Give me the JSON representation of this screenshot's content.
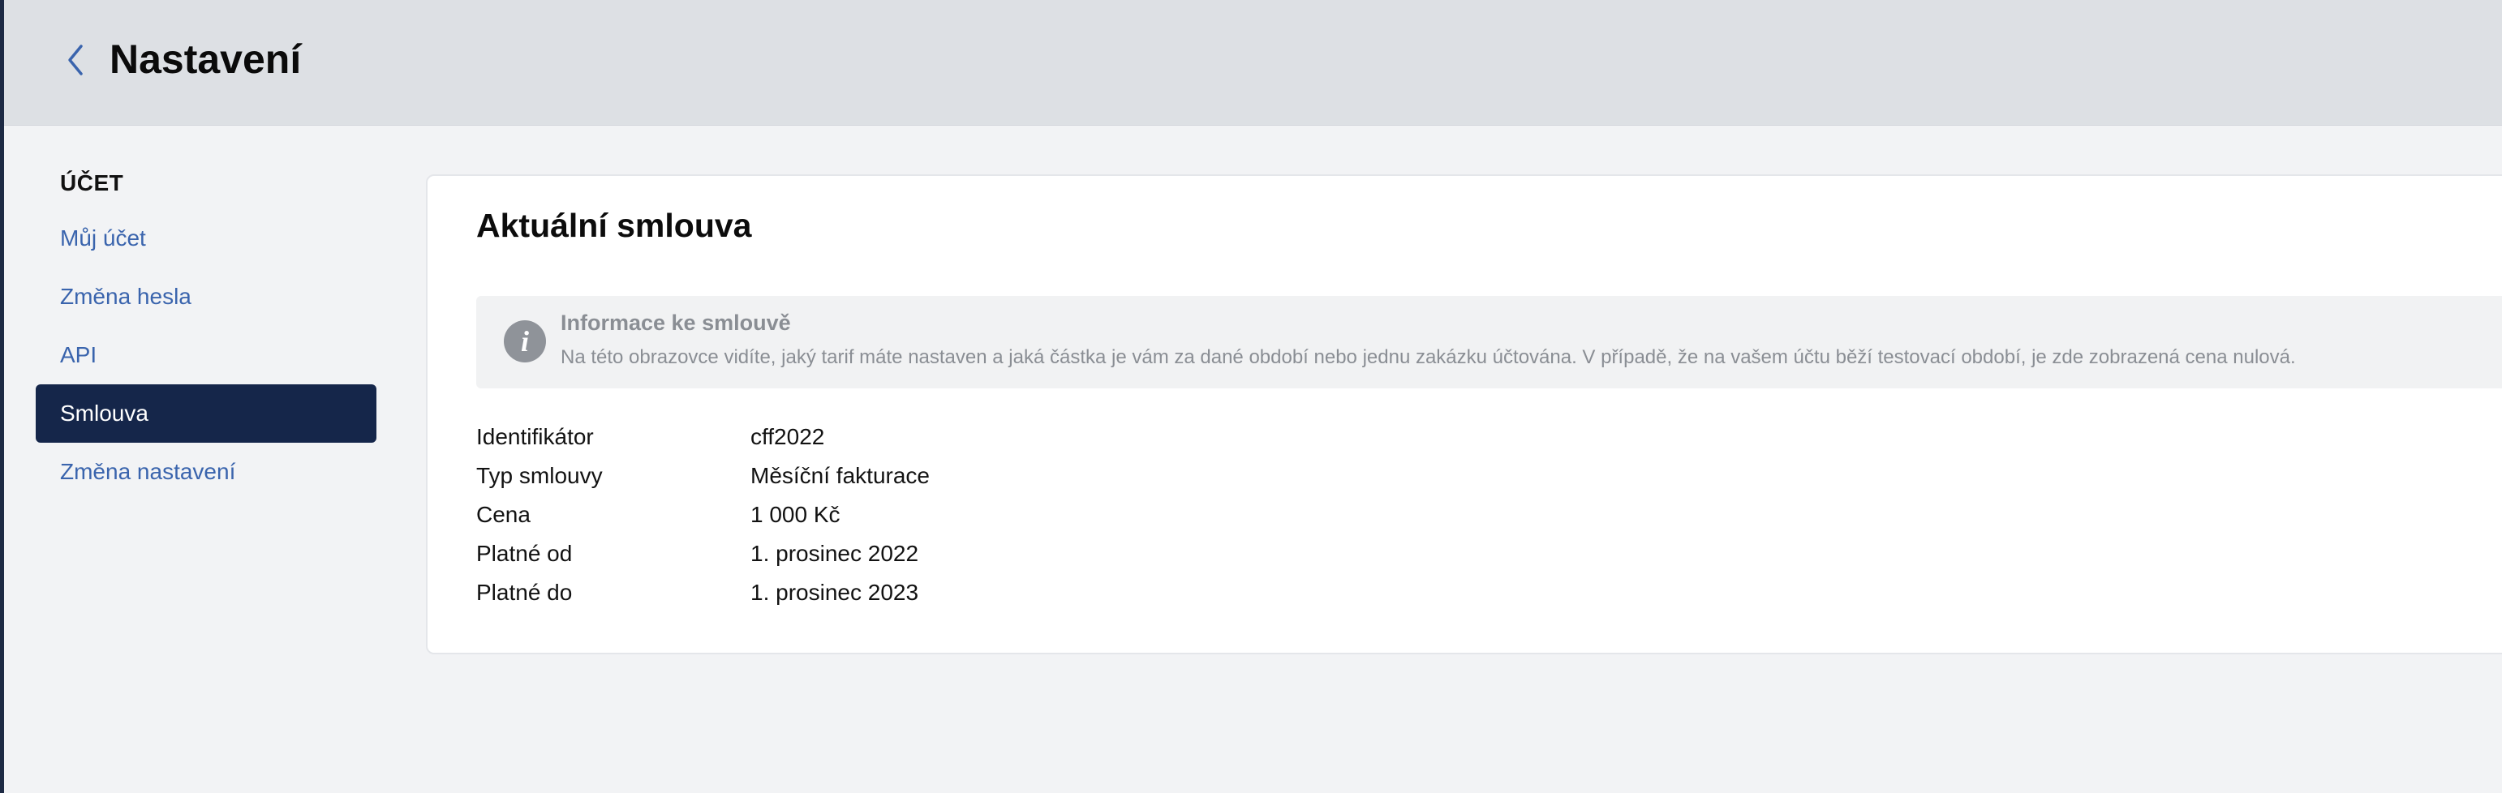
{
  "header": {
    "back_icon": "chevron-left-icon",
    "title": "Nastavení"
  },
  "sidebar": {
    "section_title": "ÚČET",
    "items": [
      {
        "label": "Můj účet",
        "active": false
      },
      {
        "label": "Změna hesla",
        "active": false
      },
      {
        "label": "API",
        "active": false
      },
      {
        "label": "Smlouva",
        "active": true
      },
      {
        "label": "Změna nastavení",
        "active": false
      }
    ]
  },
  "content": {
    "title": "Aktuální smlouva",
    "info": {
      "icon": "info-icon",
      "title": "Informace ke smlouvě",
      "text": "Na této obrazovce vidíte, jaký tarif máte nastaven a jaká částka je vám za dané období nebo jednu zakázku účtována. V případě, že na vašem účtu běží testovací období, je zde zobrazená cena nulová."
    },
    "details": [
      {
        "label": "Identifikátor",
        "value": "cff2022"
      },
      {
        "label": "Typ smlouvy",
        "value": "Měsíční fakturace"
      },
      {
        "label": "Cena",
        "value": "1 000 Kč"
      },
      {
        "label": "Platné od",
        "value": "1. prosinec 2022"
      },
      {
        "label": "Platné do",
        "value": "1. prosinec 2023"
      }
    ]
  },
  "colors": {
    "accent": "#3a64ad",
    "active_nav_bg": "#15264a",
    "header_bg": "#dde0e4",
    "page_bg": "#f2f3f5"
  }
}
